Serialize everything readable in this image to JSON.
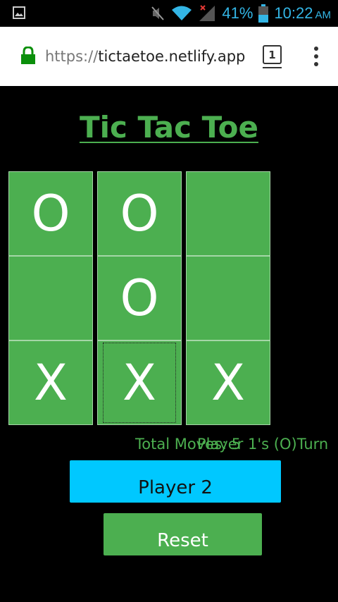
{
  "status_bar": {
    "battery_pct": "41%",
    "time": "10:22",
    "ampm": "AM",
    "icons": [
      "image-icon",
      "mute-icon",
      "wifi-icon",
      "signal-icon",
      "battery-icon"
    ],
    "accent_color": "#33b5e5"
  },
  "browser": {
    "url_scheme": "https://",
    "url_host": "tictaetoe.netlify.app",
    "tab_count": "1"
  },
  "game": {
    "title": "Tic Tac Toe",
    "cells": [
      "O",
      "O",
      "",
      "",
      "O",
      "",
      "X",
      "X",
      "X"
    ],
    "moves_text": "Total Moves: 5",
    "turn_text": "Player 1's (O)Turn",
    "player_button": "Player 2",
    "reset_button": "Reset",
    "colors": {
      "green": "#4caf50",
      "cyan": "#00c8ff",
      "background": "#000000"
    }
  }
}
